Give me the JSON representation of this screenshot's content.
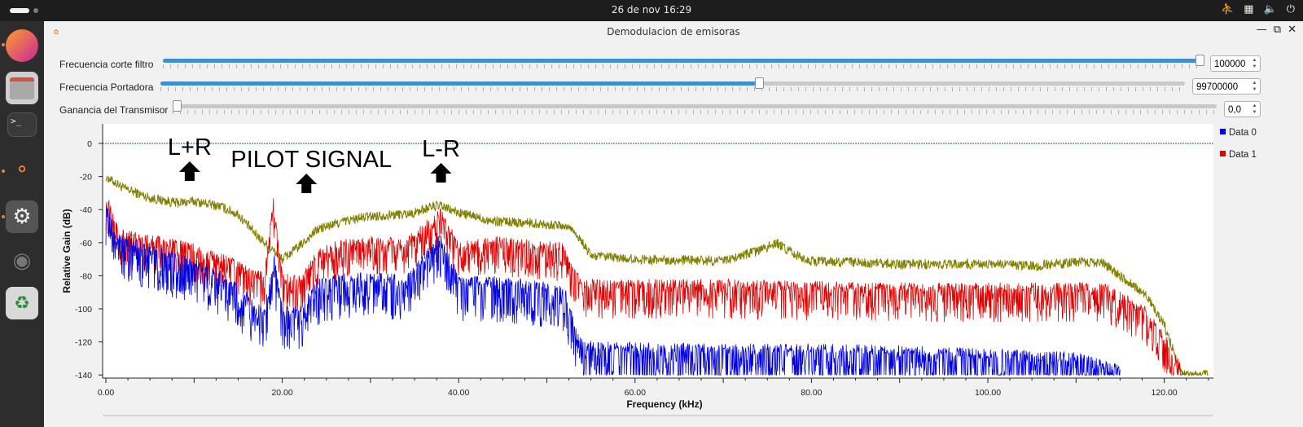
{
  "topbar": {
    "clock": "26 de nov  16:29"
  },
  "window": {
    "title": "Demodulacion de emisoras"
  },
  "controls": [
    {
      "label": "Frecuencia corte filtro",
      "value": "100000",
      "fill": 1.0
    },
    {
      "label": "Frecuencia Portadora",
      "value": "99700000",
      "fill": 0.585
    },
    {
      "label": "Ganancia del Transmisor",
      "value": "0,0",
      "fill": 0.0
    }
  ],
  "icons": [
    "app-icon",
    "minimize-icon",
    "restore-icon",
    "close-icon",
    "accessibility-icon",
    "network-icon",
    "volume-icon",
    "power-icon",
    "firefox-icon",
    "files-icon",
    "terminal-icon",
    "gnuradio-icon",
    "settings-icon",
    "disk-icon",
    "trash-icon"
  ],
  "chart_data": {
    "type": "line",
    "xlabel": "Frequency (kHz)",
    "ylabel": "Relative Gain (dB)",
    "xlim": [
      0,
      125
    ],
    "ylim": [
      -140,
      5
    ],
    "x_ticks": [
      "0.00",
      "20.00",
      "40.00",
      "60.00",
      "80.00",
      "100.00",
      "120.00"
    ],
    "y_ticks": [
      "0",
      "-20",
      "-40",
      "-60",
      "-80",
      "-100",
      "-120",
      "-140"
    ],
    "legend": "right",
    "legend_entries": [
      "Data 0",
      "Data 1"
    ],
    "colors": {
      "data0": "#0000e0",
      "data1": "#e00000",
      "max_hold": "#808000",
      "ref": "#0a5f8a"
    },
    "annotations": [
      {
        "text": "L+R",
        "x_khz": 9.5
      },
      {
        "text": "PILOT SIGNAL",
        "x_khz": 22
      },
      {
        "text": "L-R",
        "x_khz": 38
      }
    ],
    "reference_line": 0,
    "series": [
      {
        "name": "",
        "color": "#808000",
        "x": [
          0,
          2,
          5,
          8,
          10,
          13,
          15,
          17,
          19,
          20,
          22,
          24,
          27,
          30,
          33,
          35,
          37,
          38,
          40,
          44,
          48,
          50,
          52,
          53,
          55,
          60,
          70,
          74,
          76,
          78,
          80,
          90,
          100,
          105,
          110,
          113,
          115,
          118,
          120,
          122,
          125
        ],
        "y": [
          -20,
          -27,
          -33,
          -36,
          -35,
          -38,
          -43,
          -55,
          -65,
          -70,
          -62,
          -52,
          -47,
          -44,
          -43,
          -42,
          -38,
          -38,
          -42,
          -47,
          -48,
          -49,
          -50,
          -52,
          -68,
          -70,
          -71,
          -65,
          -60,
          -67,
          -71,
          -73,
          -73,
          -74,
          -72,
          -72,
          -80,
          -92,
          -110,
          -140,
          -140
        ]
      },
      {
        "name": "Data 1",
        "color": "#e00000",
        "x": [
          0,
          1,
          2,
          4,
          6,
          8,
          10,
          12,
          14,
          16,
          18,
          19,
          20,
          22,
          24,
          26,
          28,
          30,
          34,
          38,
          40,
          44,
          48,
          52,
          53,
          54,
          60,
          70,
          80,
          90,
          100,
          110,
          113,
          115,
          118,
          120,
          122
        ],
        "y": [
          -35,
          -50,
          -58,
          -60,
          -62,
          -64,
          -66,
          -70,
          -74,
          -80,
          -84,
          -38,
          -84,
          -86,
          -70,
          -65,
          -63,
          -62,
          -63,
          -45,
          -65,
          -62,
          -64,
          -66,
          -80,
          -88,
          -88,
          -88,
          -89,
          -90,
          -90,
          -90,
          -90,
          -95,
          -105,
          -120,
          -140
        ]
      },
      {
        "name": "Data 0",
        "color": "#0000e0",
        "x": [
          0,
          1,
          2,
          4,
          6,
          8,
          10,
          12,
          14,
          16,
          18,
          19,
          20,
          22,
          24,
          26,
          28,
          30,
          34,
          38,
          40,
          44,
          48,
          52,
          53,
          54,
          60,
          70,
          80,
          90,
          100,
          110,
          115
        ],
        "y": [
          -40,
          -58,
          -62,
          -65,
          -68,
          -72,
          -75,
          -80,
          -86,
          -96,
          -106,
          -70,
          -104,
          -104,
          -88,
          -85,
          -84,
          -84,
          -85,
          -60,
          -86,
          -86,
          -88,
          -92,
          -110,
          -125,
          -126,
          -127,
          -127,
          -128,
          -130,
          -132,
          -140
        ]
      }
    ]
  }
}
